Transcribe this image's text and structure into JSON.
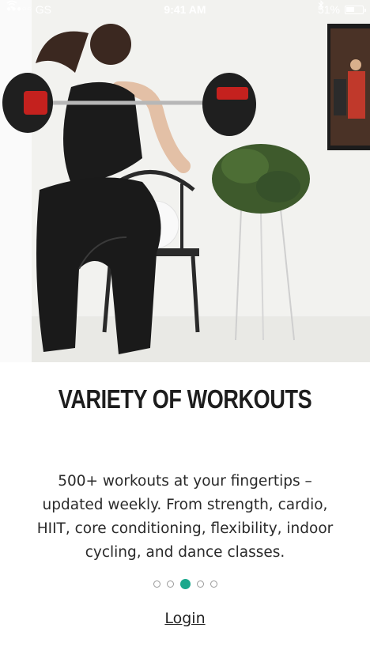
{
  "status_bar": {
    "signal": "●●●○○",
    "carrier": "GS",
    "time": "9:41 AM",
    "battery_percent": "51%",
    "battery_level": 0.51
  },
  "hero": {
    "icon": "woman-squatting-with-barbell-photo"
  },
  "onboarding": {
    "title": "VARIETY OF WORKOUTS",
    "description": "500+ workouts at your fingertips – updated weekly. From strength, cardio, HIIT, core conditioning, flexibility, indoor cycling, and dance classes.",
    "page_count": 5,
    "active_page_index": 2,
    "accent_color": "#1aa88c"
  },
  "login_label": "Login"
}
